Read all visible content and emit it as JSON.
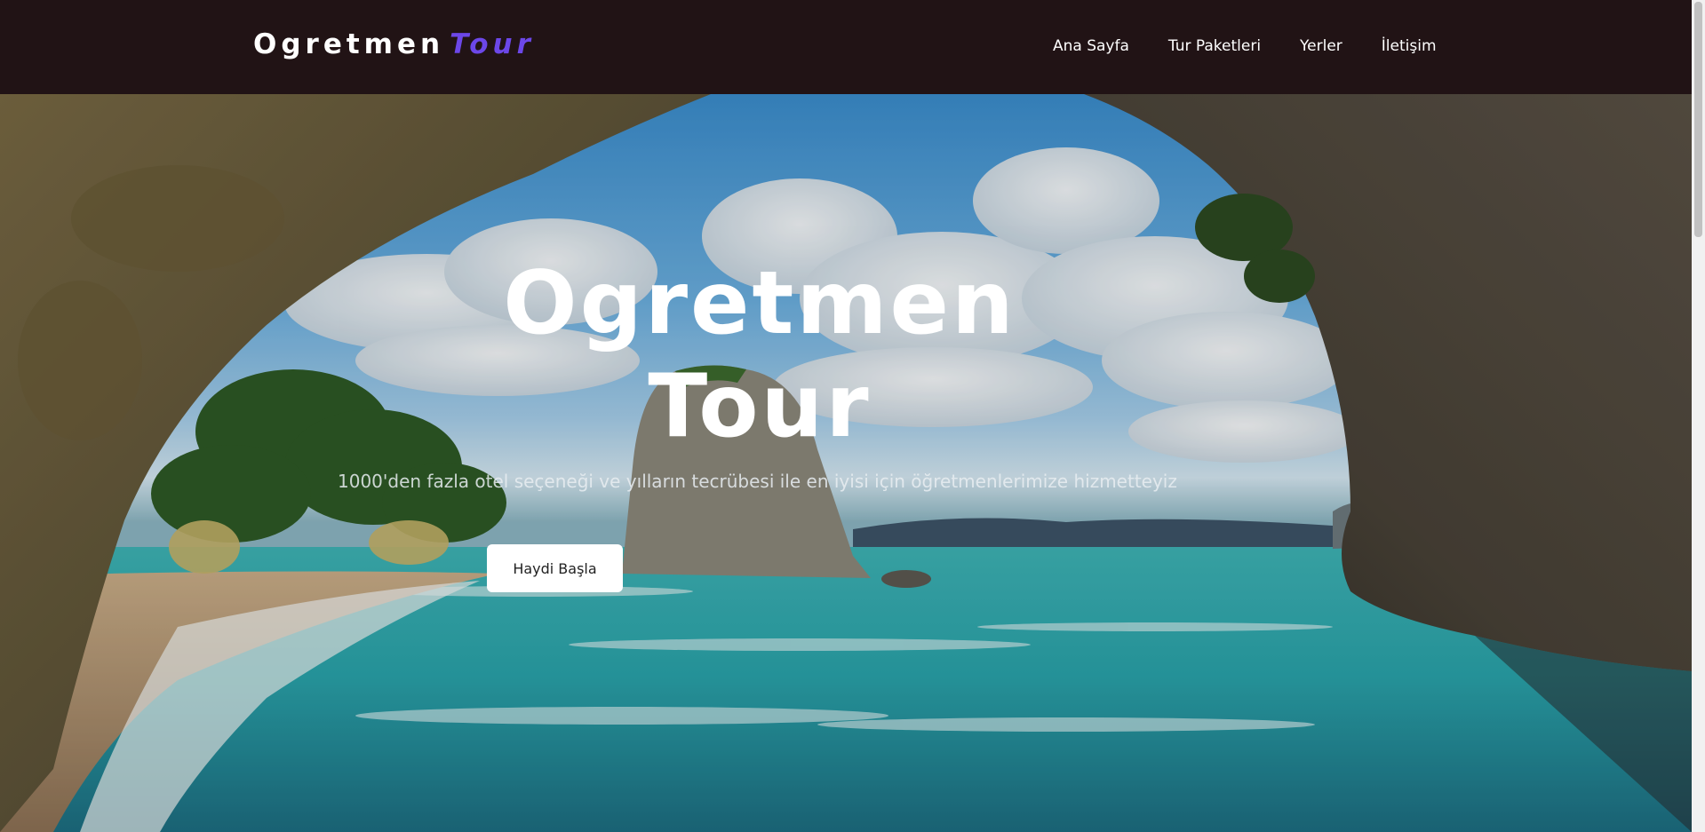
{
  "header": {
    "brand_main": "Ogretmen",
    "brand_accent": "Tour",
    "nav": [
      "Ana Sayfa",
      "Tur Paketleri",
      "Yerler",
      "İletişim"
    ]
  },
  "hero": {
    "title_line1": "Ogretmen",
    "title_line2": "Tour",
    "subtitle": "1000'den fazla otel seçeneği ve yılların tecrübesi ile en iyisi için öğretmenlerimize hizmetteyiz",
    "cta_label": "Haydi Başla"
  },
  "colors": {
    "header_bg": "#211315",
    "brand_accent": "#6c47e8"
  }
}
